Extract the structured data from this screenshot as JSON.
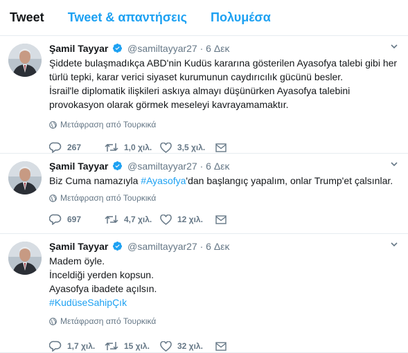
{
  "tabs": [
    {
      "label": "Tweet"
    },
    {
      "label": "Tweet & απαντήσεις"
    },
    {
      "label": "Πολυμέσα"
    }
  ],
  "tweets": [
    {
      "name": "Şamil Tayyar",
      "handle": "@samiltayyar27",
      "separator": "·",
      "date": "6 Δεκ",
      "lines": [
        "Şiddete bulaşmadıkça ABD'nin Kudüs kararına gösterilen Ayasofya talebi gibi her",
        "türlü tepki, karar verici siyaset kurumunun caydırıcılık gücünü besler.",
        "İsrail'le diplomatik ilişkileri askıya almayı düşünürken Ayasofya talebini",
        "provokasyon olarak görmek meseleyi kavrayamamaktır."
      ],
      "translate": "Μετάφραση από Τουρκικά",
      "replies": "267",
      "retweets": "1,0 χιλ.",
      "likes": "3,5 χιλ."
    },
    {
      "name": "Şamil Tayyar",
      "handle": "@samiltayyar27",
      "separator": "·",
      "date": "6 Δεκ",
      "text_before": "Biz Cuma namazıyla ",
      "hashtag": "#Ayasofya",
      "text_after": "'dan başlangıç yapalım, onlar Trump'et çalsınlar.",
      "translate": "Μετάφραση από Τουρκικά",
      "replies": "697",
      "retweets": "4,7 χιλ.",
      "likes": "12 χιλ."
    },
    {
      "name": "Şamil Tayyar",
      "handle": "@samiltayyar27",
      "separator": "·",
      "date": "6 Δεκ",
      "lines": [
        "Madem öyle.",
        "İnceldiği yerden kopsun.",
        "Ayasofya ibadete açılsın."
      ],
      "hashtag": "#KudüseSahipÇık",
      "translate": "Μετάφραση από Τουρκικά",
      "replies": "1,7 χιλ.",
      "retweets": "15 χιλ.",
      "likes": "32 χιλ."
    }
  ],
  "icons": {
    "verified": "verified-badge-icon",
    "caret": "chevron-down-icon",
    "globe": "globe-icon",
    "reply": "reply-icon",
    "retweet": "retweet-icon",
    "like": "heart-icon",
    "message": "envelope-icon"
  },
  "colors": {
    "accent": "#1da1f2",
    "muted": "#657786",
    "text": "#14171a",
    "border": "#e6ecf0"
  }
}
